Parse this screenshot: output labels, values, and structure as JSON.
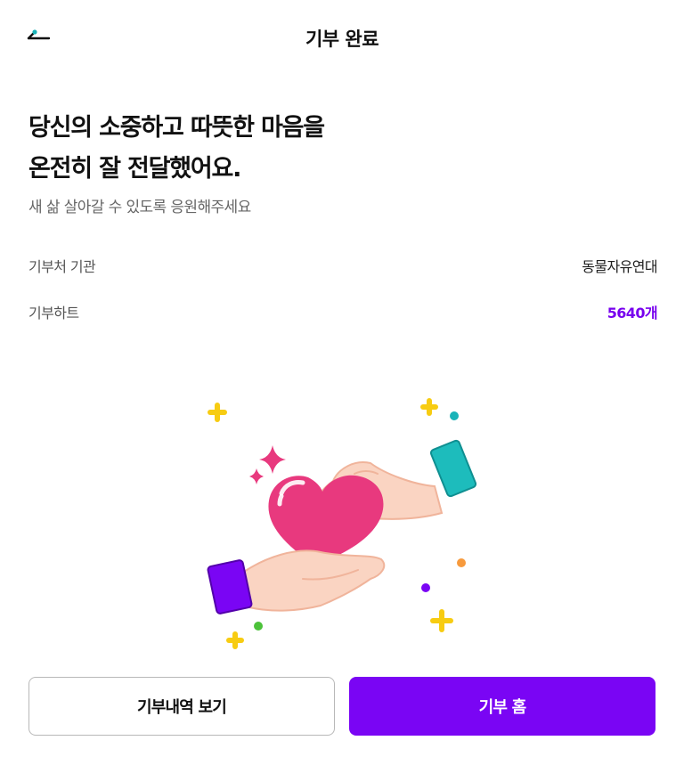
{
  "header": {
    "title": "기부 완료",
    "back_icon": "back-arrow-icon"
  },
  "message": {
    "line1": "당신의 소중하고 따뜻한 마음을",
    "line2": "온전히 잘 전달했어요.",
    "subtitle": "새 삶 살아갈 수 있도록 응원해주세요"
  },
  "details": {
    "org_label": "기부처 기관",
    "org_value": "동물자유연대",
    "heart_label": "기부하트",
    "heart_value": "5640개"
  },
  "illustration": {
    "icon": "hands-giving-heart-illustration"
  },
  "buttons": {
    "history_label": "기부내역 보기",
    "home_label": "기부 홈"
  },
  "colors": {
    "accent": "#7a05f4",
    "heart": "#e8397e",
    "sparkle_yellow": "#f7cc12"
  }
}
